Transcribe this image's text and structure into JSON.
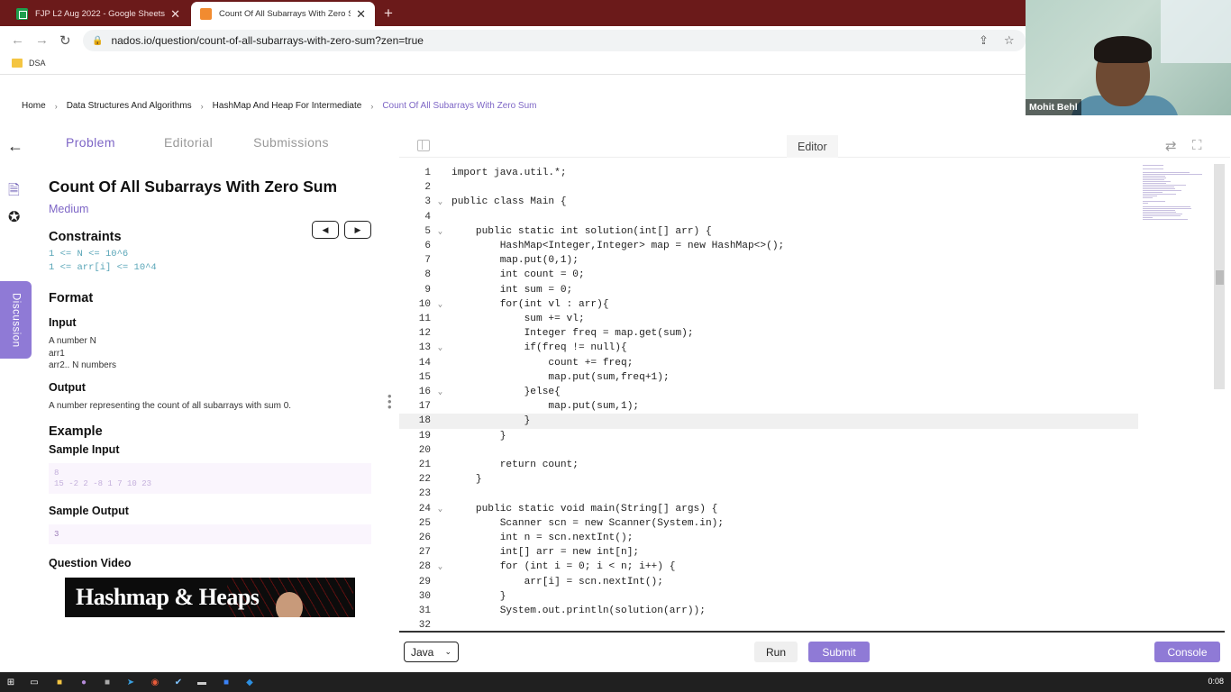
{
  "browser": {
    "tabs": [
      {
        "label": "FJP L2 Aug 2022 - Google Sheets",
        "favicon": "sheets-icon"
      },
      {
        "label": "Count Of All Subarrays With Zero Sum",
        "favicon": "nados-icon"
      }
    ],
    "url": "nados.io/question/count-of-all-subarrays-with-zero-sum?zen=true",
    "bookmark": "DSA"
  },
  "webcam": {
    "name": "Mohit Behl"
  },
  "breadcrumb": [
    "Home",
    "Data Structures And Algorithms",
    "HashMap And Heap For Intermediate",
    "Count Of All Subarrays With Zero Sum"
  ],
  "sidebar": {
    "discussion_label": "Discussion"
  },
  "problem_tabs": [
    "Problem",
    "Editorial",
    "Submissions"
  ],
  "problem": {
    "title": "Count Of All Subarrays With Zero Sum",
    "difficulty": "Medium",
    "constraints_heading": "Constraints",
    "constraints": [
      "1 <= N <= 10^6",
      "1 <= arr[i] <= 10^4"
    ],
    "format_heading": "Format",
    "input_heading": "Input",
    "input_lines": [
      "A number N",
      "arr1",
      "arr2.. N numbers"
    ],
    "output_heading": "Output",
    "output_text": "A number representing the count of all subarrays with sum 0.",
    "example_heading": "Example",
    "sample_input_heading": "Sample Input",
    "sample_input": [
      "8",
      "15 -2 2 -8 1 7 10 23"
    ],
    "sample_output_heading": "Sample Output",
    "sample_output": "3",
    "video_heading": "Question Video",
    "video_title": "Hashmap & Heaps"
  },
  "editor": {
    "tab_label": "Editor",
    "current_line": 18,
    "lines": [
      {
        "n": "1",
        "fold": "",
        "text": "import java.util.*;"
      },
      {
        "n": "2",
        "fold": "",
        "text": ""
      },
      {
        "n": "3",
        "fold": "v",
        "text": "public class Main {"
      },
      {
        "n": "4",
        "fold": "",
        "text": ""
      },
      {
        "n": "5",
        "fold": "v",
        "text": "    public static int solution(int[] arr) {"
      },
      {
        "n": "6",
        "fold": "",
        "text": "        HashMap<Integer,Integer> map = new HashMap<>();"
      },
      {
        "n": "7",
        "fold": "",
        "text": "        map.put(0,1);"
      },
      {
        "n": "8",
        "fold": "",
        "text": "        int count = 0;"
      },
      {
        "n": "9",
        "fold": "",
        "text": "        int sum = 0;"
      },
      {
        "n": "10",
        "fold": "v",
        "text": "        for(int vl : arr){"
      },
      {
        "n": "11",
        "fold": "",
        "text": "            sum += vl;"
      },
      {
        "n": "12",
        "fold": "",
        "text": "            Integer freq = map.get(sum);"
      },
      {
        "n": "13",
        "fold": "v",
        "text": "            if(freq != null){"
      },
      {
        "n": "14",
        "fold": "",
        "text": "                count += freq;"
      },
      {
        "n": "15",
        "fold": "",
        "text": "                map.put(sum,freq+1);"
      },
      {
        "n": "16",
        "fold": "v",
        "text": "            }else{"
      },
      {
        "n": "17",
        "fold": "",
        "text": "                map.put(sum,1);"
      },
      {
        "n": "18",
        "fold": "",
        "text": "            }"
      },
      {
        "n": "19",
        "fold": "",
        "text": "        }"
      },
      {
        "n": "20",
        "fold": "",
        "text": ""
      },
      {
        "n": "21",
        "fold": "",
        "text": "        return count;"
      },
      {
        "n": "22",
        "fold": "",
        "text": "    }"
      },
      {
        "n": "23",
        "fold": "",
        "text": ""
      },
      {
        "n": "24",
        "fold": "v",
        "text": "    public static void main(String[] args) {"
      },
      {
        "n": "25",
        "fold": "",
        "text": "        Scanner scn = new Scanner(System.in);"
      },
      {
        "n": "26",
        "fold": "",
        "text": "        int n = scn.nextInt();"
      },
      {
        "n": "27",
        "fold": "",
        "text": "        int[] arr = new int[n];"
      },
      {
        "n": "28",
        "fold": "v",
        "text": "        for (int i = 0; i < n; i++) {"
      },
      {
        "n": "29",
        "fold": "",
        "text": "            arr[i] = scn.nextInt();"
      },
      {
        "n": "30",
        "fold": "",
        "text": "        }"
      },
      {
        "n": "31",
        "fold": "",
        "text": "        System.out.println(solution(arr));"
      },
      {
        "n": "32",
        "fold": "",
        "text": ""
      }
    ]
  },
  "bottom_bar": {
    "language": "Java",
    "run_label": "Run",
    "submit_label": "Submit",
    "console_label": "Console"
  },
  "taskbar": {
    "clock": "0:08"
  },
  "colors": {
    "accent": "#8f7ad6",
    "accent_text": "#7e66c6",
    "tabbar": "#6b1a1a",
    "constraint_teal": "#5aa6b8"
  }
}
